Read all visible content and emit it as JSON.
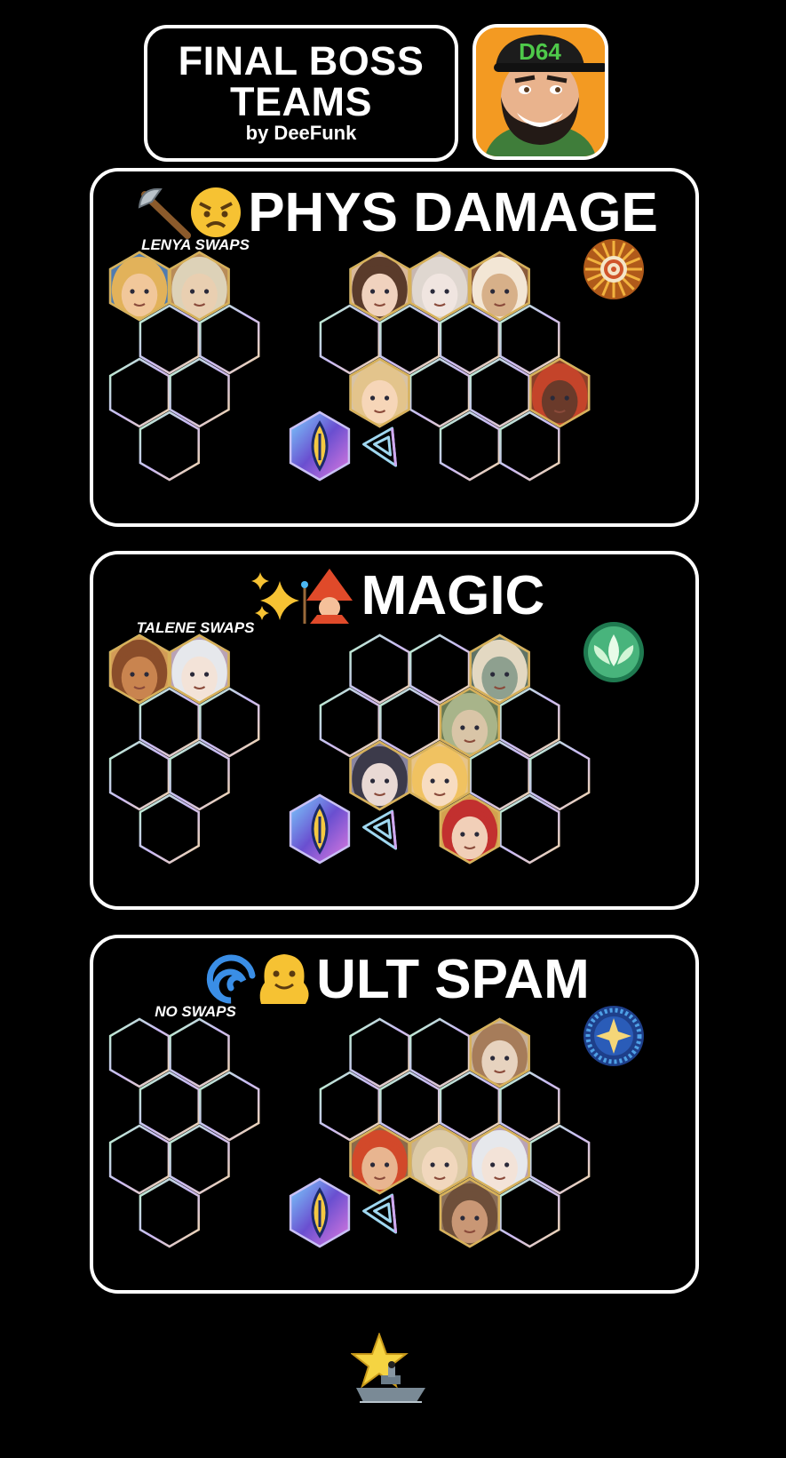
{
  "header": {
    "title": "FINAL BOSS TEAMS",
    "subtitle": "by DeeFunk",
    "avatar_cap_text": "D64",
    "avatar_name": "deefunk-avatar"
  },
  "colors": {
    "background": "#000000",
    "panel_border": "#ffffff",
    "hex_gradient": [
      "#b9f5c8",
      "#c9b8f5",
      "#f3d9a4"
    ],
    "gold_frame": "#d7b15a",
    "logo_blue": "#4bb7f2"
  },
  "sections": [
    {
      "key": "phys",
      "title": "PHYS DAMAGE",
      "emoji": [
        "axe-icon",
        "angry-face-icon"
      ],
      "swaps_label": "LENYA SWAPS",
      "artifact": "orange-target-artifact",
      "swap_heroes": [
        {
          "name": "blond-hero-portrait",
          "skin": "#f1c79a",
          "hair": "#e2b25a",
          "bg": "#4f7bb0"
        },
        {
          "name": "pale-hero-portrait",
          "skin": "#e9cfb1",
          "hair": "#ddd2b8",
          "bg": "#b88b58"
        }
      ],
      "team_heroes": [
        {
          "name": "curly-hair-hero-portrait",
          "skin": "#f0d2be",
          "hair": "#5a3b2b",
          "bg": "#d9b99b"
        },
        {
          "name": "white-haired-hero-portrait",
          "skin": "#f0e5e0",
          "hair": "#dfd7d0",
          "bg": "#c7b7b0"
        },
        {
          "name": "beast-hero-portrait",
          "skin": "#d7b089",
          "hair": "#f3e6d5",
          "bg": "#8a5a3a"
        },
        {
          "name": "blonde-hero-portrait",
          "skin": "#f6d6b8",
          "hair": "#e3c48c",
          "bg": "#d8c3a5"
        },
        {
          "name": "lion-hero-portrait",
          "skin": "#6a3a2a",
          "hair": "#c4442a",
          "bg": "#8a4028"
        }
      ],
      "pet": "blue-flame-pet-icon",
      "logo": "afk-logo-icon"
    },
    {
      "key": "magic",
      "title": "MAGIC",
      "emoji": [
        "sparkles-icon",
        "wizard-icon"
      ],
      "swaps_label": "TALENE SWAPS",
      "artifact": "green-leaf-artifact",
      "swap_heroes": [
        {
          "name": "fox-hero-portrait",
          "skin": "#c9844f",
          "hair": "#8a4d2a",
          "bg": "#d39b57"
        },
        {
          "name": "silver-hair-hero-portrait",
          "skin": "#f3e3d8",
          "hair": "#e6e8ec",
          "bg": "#b9a2b5"
        }
      ],
      "team_heroes": [
        {
          "name": "crowned-beast-hero-portrait",
          "skin": "#8ea08f",
          "hair": "#e3d8c2",
          "bg": "#5f7366"
        },
        {
          "name": "elf-hero-portrait",
          "skin": "#d9c5a7",
          "hair": "#a8b48a",
          "bg": "#6a7b54"
        },
        {
          "name": "dark-hair-hero-portrait",
          "skin": "#e9d9d4",
          "hair": "#3c3a4a",
          "bg": "#8b86a1"
        },
        {
          "name": "golden-curls-hero-portrait",
          "skin": "#f7dcc1",
          "hair": "#f0c261",
          "bg": "#e7c48a"
        },
        {
          "name": "red-hair-hero-portrait",
          "skin": "#f1cfb8",
          "hair": "#c2302f",
          "bg": "#d3a14f"
        }
      ],
      "pet": "blue-flame-pet-icon",
      "logo": "afk-logo-icon"
    },
    {
      "key": "ult",
      "title": "ULT SPAM",
      "emoji": [
        "cyclone-icon",
        "melting-face-icon"
      ],
      "swaps_label": "NO SWAPS",
      "artifact": "blue-star-artifact",
      "swap_heroes": [],
      "team_heroes": [
        {
          "name": "bear-hero-portrait",
          "skin": "#e7d3bf",
          "hair": "#a67c5a",
          "bg": "#c9b29a"
        },
        {
          "name": "red-spiky-hero-portrait",
          "skin": "#e8b590",
          "hair": "#d2492a",
          "bg": "#8c6a4a"
        },
        {
          "name": "sandy-hair-hero-portrait",
          "skin": "#f1d7bd",
          "hair": "#dccaa6",
          "bg": "#c6b08c"
        },
        {
          "name": "silver-hair-hero-portrait",
          "skin": "#f3e3d8",
          "hair": "#e6e8ec",
          "bg": "#b9a2b5"
        },
        {
          "name": "bearded-hero-portrait",
          "skin": "#c99775",
          "hair": "#6e4f3a",
          "bg": "#8c705a"
        }
      ],
      "pet": "blue-flame-pet-icon",
      "logo": "afk-logo-icon"
    }
  ],
  "footer": {
    "icon": "star-battleship-icon"
  }
}
